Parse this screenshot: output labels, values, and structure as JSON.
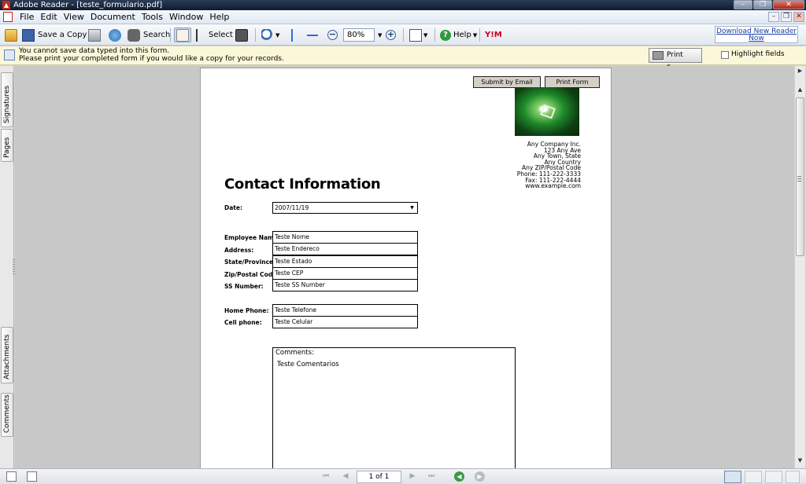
{
  "window": {
    "title": "Adobe Reader - [teste_formulario.pdf]",
    "app_icon": "adobe-reader-icon",
    "controls": [
      "minimize",
      "restore",
      "close"
    ]
  },
  "menu": {
    "items": [
      "File",
      "Edit",
      "View",
      "Document",
      "Tools",
      "Window",
      "Help"
    ]
  },
  "toolbar": {
    "save_copy_label": "Save a Copy",
    "search_label": "Search",
    "select_label": "Select",
    "zoom_value": "80%",
    "help_label": "Help",
    "download_label": "Download New Reader Now"
  },
  "message_bar": {
    "line1": "You cannot save data typed into this form.",
    "line2": "Please print your completed form if you would like a copy for your records.",
    "print_form_label": "Print Form",
    "highlight_fields_label": "Highlight fields",
    "highlight_checked": false
  },
  "left_tabs": [
    "Signatures",
    "Pages",
    "Attachments",
    "Comments"
  ],
  "document": {
    "submit_email_label": "Submit by Email",
    "print_form_label": "Print Form",
    "company": {
      "name": "Any Company Inc.",
      "address1": "123 Any Ave",
      "address2": "Any Town, State",
      "country": "Any Country",
      "zip": "Any ZIP/Postal Code",
      "phone": "Phone: 111-222-3333",
      "fax": "Fax: 111-222-4444",
      "web": "www.example.com"
    },
    "heading": "Contact Information",
    "date": {
      "label": "Date:",
      "value": "2007/11/19"
    },
    "fields": [
      {
        "label": "Employee Name:",
        "value": "Teste Nome"
      },
      {
        "label": "Address:",
        "value": "Teste Endereco"
      },
      {
        "label": "State/Province:",
        "value": "Teste Estado"
      },
      {
        "label": "Zip/Postal Code:",
        "value": "Teste CEP"
      },
      {
        "label": "SS Number:",
        "value": "Teste SS Number"
      }
    ],
    "phones": [
      {
        "label": "Home Phone:",
        "value": "Teste Telefone"
      },
      {
        "label": "Cell phone:",
        "value": "Teste Celular"
      }
    ],
    "comments": {
      "label": "Comments:",
      "value": "Teste Comentarios"
    }
  },
  "status_bar": {
    "page_indicator": "1 of 1"
  },
  "colors": {
    "message_bar_bg": "#fbf7d9",
    "document_bg": "#c8c8c8",
    "link": "#1a3fa8"
  }
}
